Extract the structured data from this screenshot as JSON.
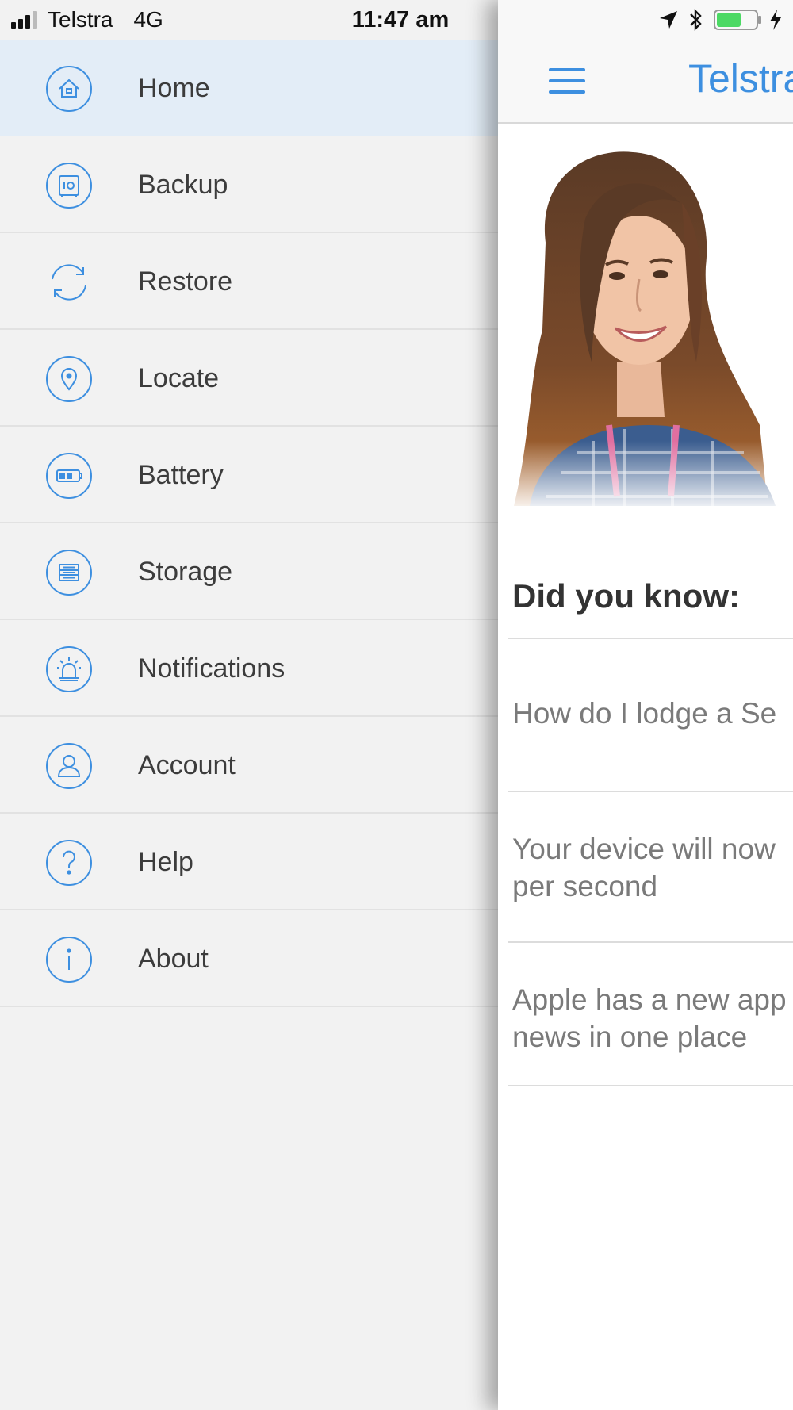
{
  "status_bar": {
    "carrier": "Telstra",
    "network": "4G",
    "time": "11:47 am",
    "icons": [
      "location-arrow-icon",
      "bluetooth-icon",
      "battery-icon",
      "charging-bolt-icon"
    ],
    "battery_color": "#4cd964"
  },
  "menu": {
    "active_color": "#e3edf7",
    "icon_color": "#3d8fe0",
    "items": [
      {
        "label": "Home",
        "icon": "home-icon",
        "active": true
      },
      {
        "label": "Backup",
        "icon": "safe-icon",
        "active": false
      },
      {
        "label": "Restore",
        "icon": "sync-icon",
        "active": false
      },
      {
        "label": "Locate",
        "icon": "location-pin-icon",
        "active": false
      },
      {
        "label": "Battery",
        "icon": "battery-level-icon",
        "active": false
      },
      {
        "label": "Storage",
        "icon": "storage-icon",
        "active": false
      },
      {
        "label": "Notifications",
        "icon": "alarm-icon",
        "active": false
      },
      {
        "label": "Account",
        "icon": "user-icon",
        "active": false
      },
      {
        "label": "Help",
        "icon": "question-icon",
        "active": false
      },
      {
        "label": "About",
        "icon": "info-icon",
        "active": false
      }
    ]
  },
  "main": {
    "title": "Telstra",
    "menu_icon": "hamburger-icon",
    "hero_image": "support-agent-photo",
    "did_you_know_title": "Did you know:",
    "tips": [
      {
        "line1": "How do I lodge a Se",
        "line2": ""
      },
      {
        "line1": "Your device will now",
        "line2": "per second"
      },
      {
        "line1": "Apple has a new app",
        "line2": "news in one place"
      }
    ]
  }
}
